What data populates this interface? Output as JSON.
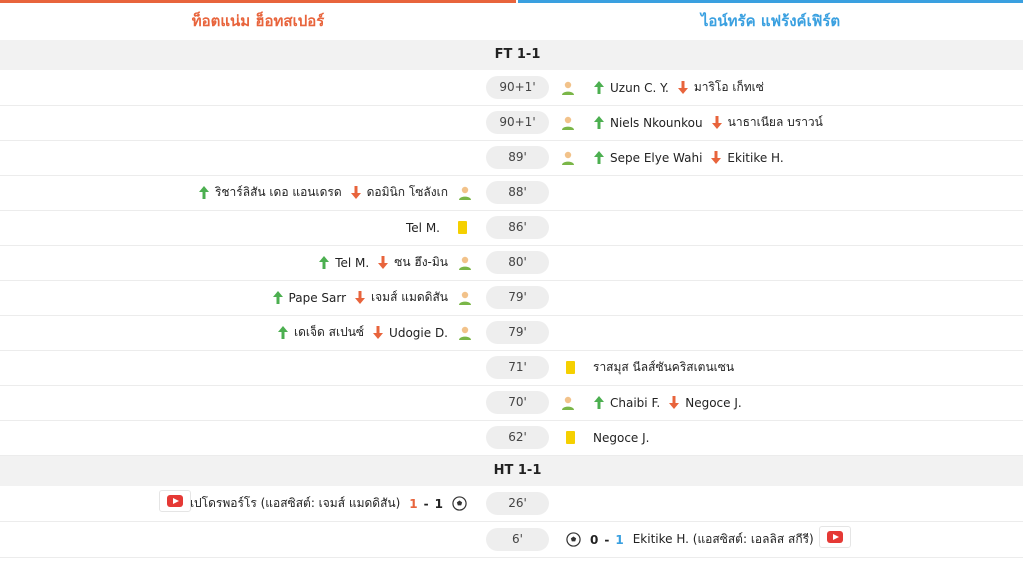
{
  "header": {
    "home_team": "ท็อตแน่ม ฮ็อทสเปอร์",
    "away_team": "ไอน์ทรัค แฟร้งค์เฟิร์ต",
    "home_color": "#e8643c",
    "away_color": "#3aa0e0"
  },
  "separators": {
    "ft": "FT 1-1",
    "ht": "HT 1-1"
  },
  "events": [
    {
      "minute": "90+1'",
      "away": {
        "in": "Uzun C. Y.",
        "out": "มาริโอ เก็ทเซ่"
      }
    },
    {
      "minute": "90+1'",
      "away": {
        "in": "Niels Nkounkou",
        "out": "นาธาเนียล บราวน์"
      }
    },
    {
      "minute": "89'",
      "away": {
        "in": "Sepe Elye Wahi",
        "out": "Ekitike H."
      }
    },
    {
      "minute": "88'",
      "home": {
        "in": "ริชาร์ลิสัน เดอ แอนเดรด",
        "out": "ดอมินิก โซลังเก"
      }
    },
    {
      "minute": "86'",
      "home": {
        "card": "Tel M."
      }
    },
    {
      "minute": "80'",
      "home": {
        "in": "Tel M.",
        "out": "ซน ฮึง-มิน"
      }
    },
    {
      "minute": "79'",
      "home": {
        "in": "Pape Sarr",
        "out": "เจมส์ แมดดิสัน"
      }
    },
    {
      "minute": "79'",
      "home": {
        "in": "เดเจ็ด สเปนซ์",
        "out": "Udogie D."
      }
    },
    {
      "minute": "71'",
      "away": {
        "card": "ราสมุส นีลส์ซันคริสเตนเซน"
      }
    },
    {
      "minute": "70'",
      "away": {
        "in": "Chaibi F.",
        "out": "Negoce J."
      }
    },
    {
      "minute": "62'",
      "away": {
        "card": "Negoce J."
      }
    },
    {
      "minute": "26'",
      "home": {
        "goal": "เปโดรพอร์โร (แอสซิสต์: เจมส์ แมดดิสัน)",
        "score_home": "1",
        "dash": "-",
        "score_away": "1"
      }
    },
    {
      "minute": "6'",
      "away": {
        "goal": "Ekitike H. (แอสซิสต์: เอลลิส สกีรี)",
        "score_home": "0",
        "dash": "-",
        "score_away": "1"
      }
    }
  ],
  "icons": {
    "sub_in": "arrow-up-icon",
    "sub_out": "arrow-down-icon",
    "player": "player-icon",
    "yellow_card": "yellow-card-icon",
    "goal": "football-icon",
    "video": "video-icon"
  }
}
